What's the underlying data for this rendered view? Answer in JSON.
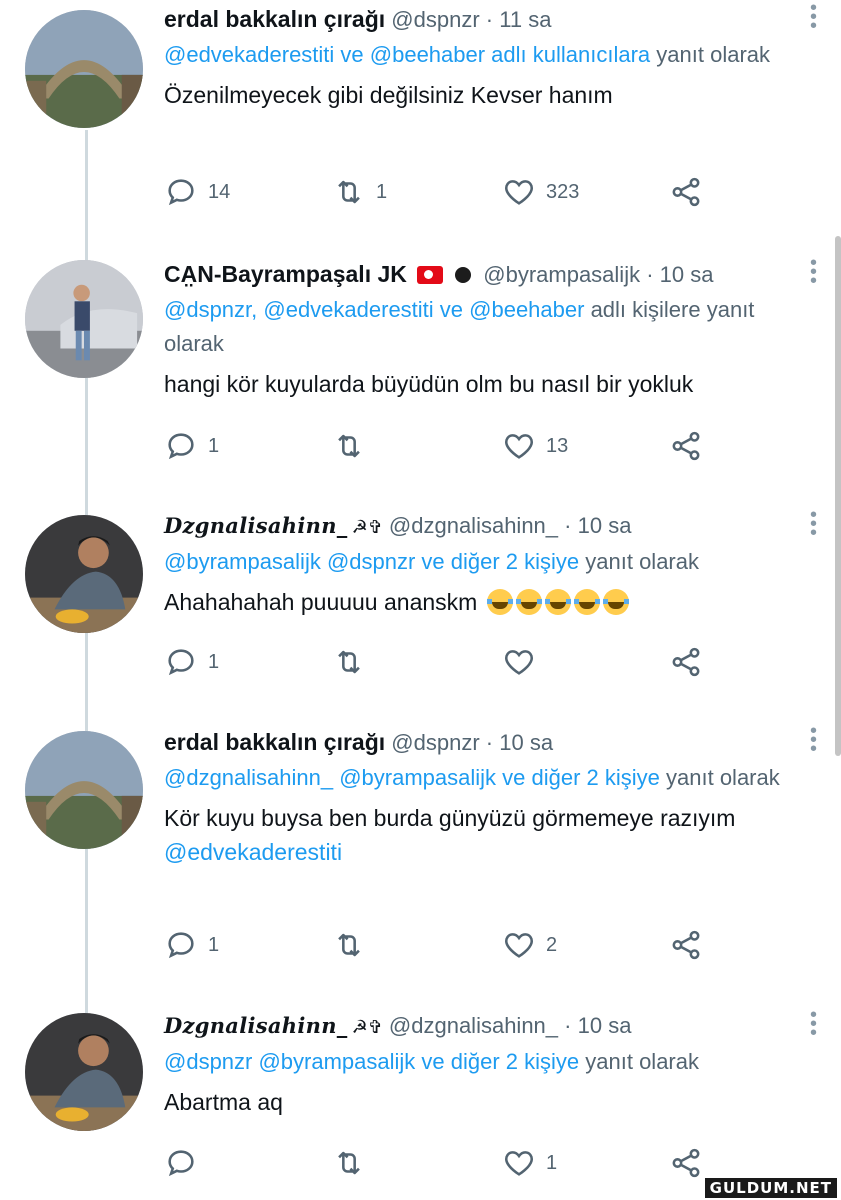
{
  "tweets": [
    {
      "name": "erdal bakkalın çırağı",
      "handle": "@dspnzr",
      "time": "11 sa",
      "reply_parts": [
        {
          "text": "@edvekaderestiti ve @beehaber adlı kullanıcılara",
          "mention": true
        },
        {
          "text": " yanıt olarak",
          "mention": false
        }
      ],
      "text": "Özenilmeyecek gibi değilsiniz Kevser hanım",
      "replies": "14",
      "retweets": "1",
      "likes": "323"
    },
    {
      "name": "CA̤N-Bayrampaşalı JK",
      "handle": "@byrampasalijk",
      "time": "10 sa",
      "reply_parts": [
        {
          "text": "@dspnzr, @edvekaderestiti ve @beehaber",
          "mention": true
        },
        {
          "text": " adlı kişilere yanıt olarak",
          "mention": false
        }
      ],
      "text": "hangi kör kuyularda büyüdün olm bu nasıl bir yokluk",
      "replies": "1",
      "retweets": "",
      "likes": "13"
    },
    {
      "name": "Dzgnalisahinn_",
      "name_glyph": "☭✞",
      "handle": "@dzgnalisahinn_",
      "time": "10 sa",
      "reply_parts": [
        {
          "text": "@byrampasalijk @dspnzr ve diğer 2 kişiye",
          "mention": true
        },
        {
          "text": " yanıt olarak",
          "mention": false
        }
      ],
      "text": "Ahahahahah puuuuu ananskm",
      "emoji_count": 5,
      "replies": "1",
      "retweets": "",
      "likes": ""
    },
    {
      "name": "erdal bakkalın çırağı",
      "handle": "@dspnzr",
      "time": "10 sa",
      "reply_parts": [
        {
          "text": "@dzgnalisahinn_ @byrampasalijk ve diğer 2 kişiye",
          "mention": true
        },
        {
          "text": " yanıt olarak",
          "mention": false
        }
      ],
      "text": "Kör kuyu buysa ben burda günyüzü görmemeye razıyım",
      "text_mention": "@edvekaderestiti",
      "replies": "1",
      "retweets": "",
      "likes": "2"
    },
    {
      "name": "Dzgnalisahinn_",
      "name_glyph": "☭✞",
      "handle": "@dzgnalisahinn_",
      "time": "10 sa",
      "reply_parts": [
        {
          "text": "@dspnzr @byrampasalijk ve diğer 2 kişiye",
          "mention": true
        },
        {
          "text": " yanıt olarak",
          "mention": false
        }
      ],
      "text": "Abartma aq",
      "replies": "",
      "retweets": "",
      "likes": "1"
    }
  ],
  "separator": "·",
  "watermark": "GULDUM.NET",
  "colors": {
    "mention": "#1d9bf0",
    "secondary": "#536471",
    "thread_line": "#cfd9de"
  }
}
